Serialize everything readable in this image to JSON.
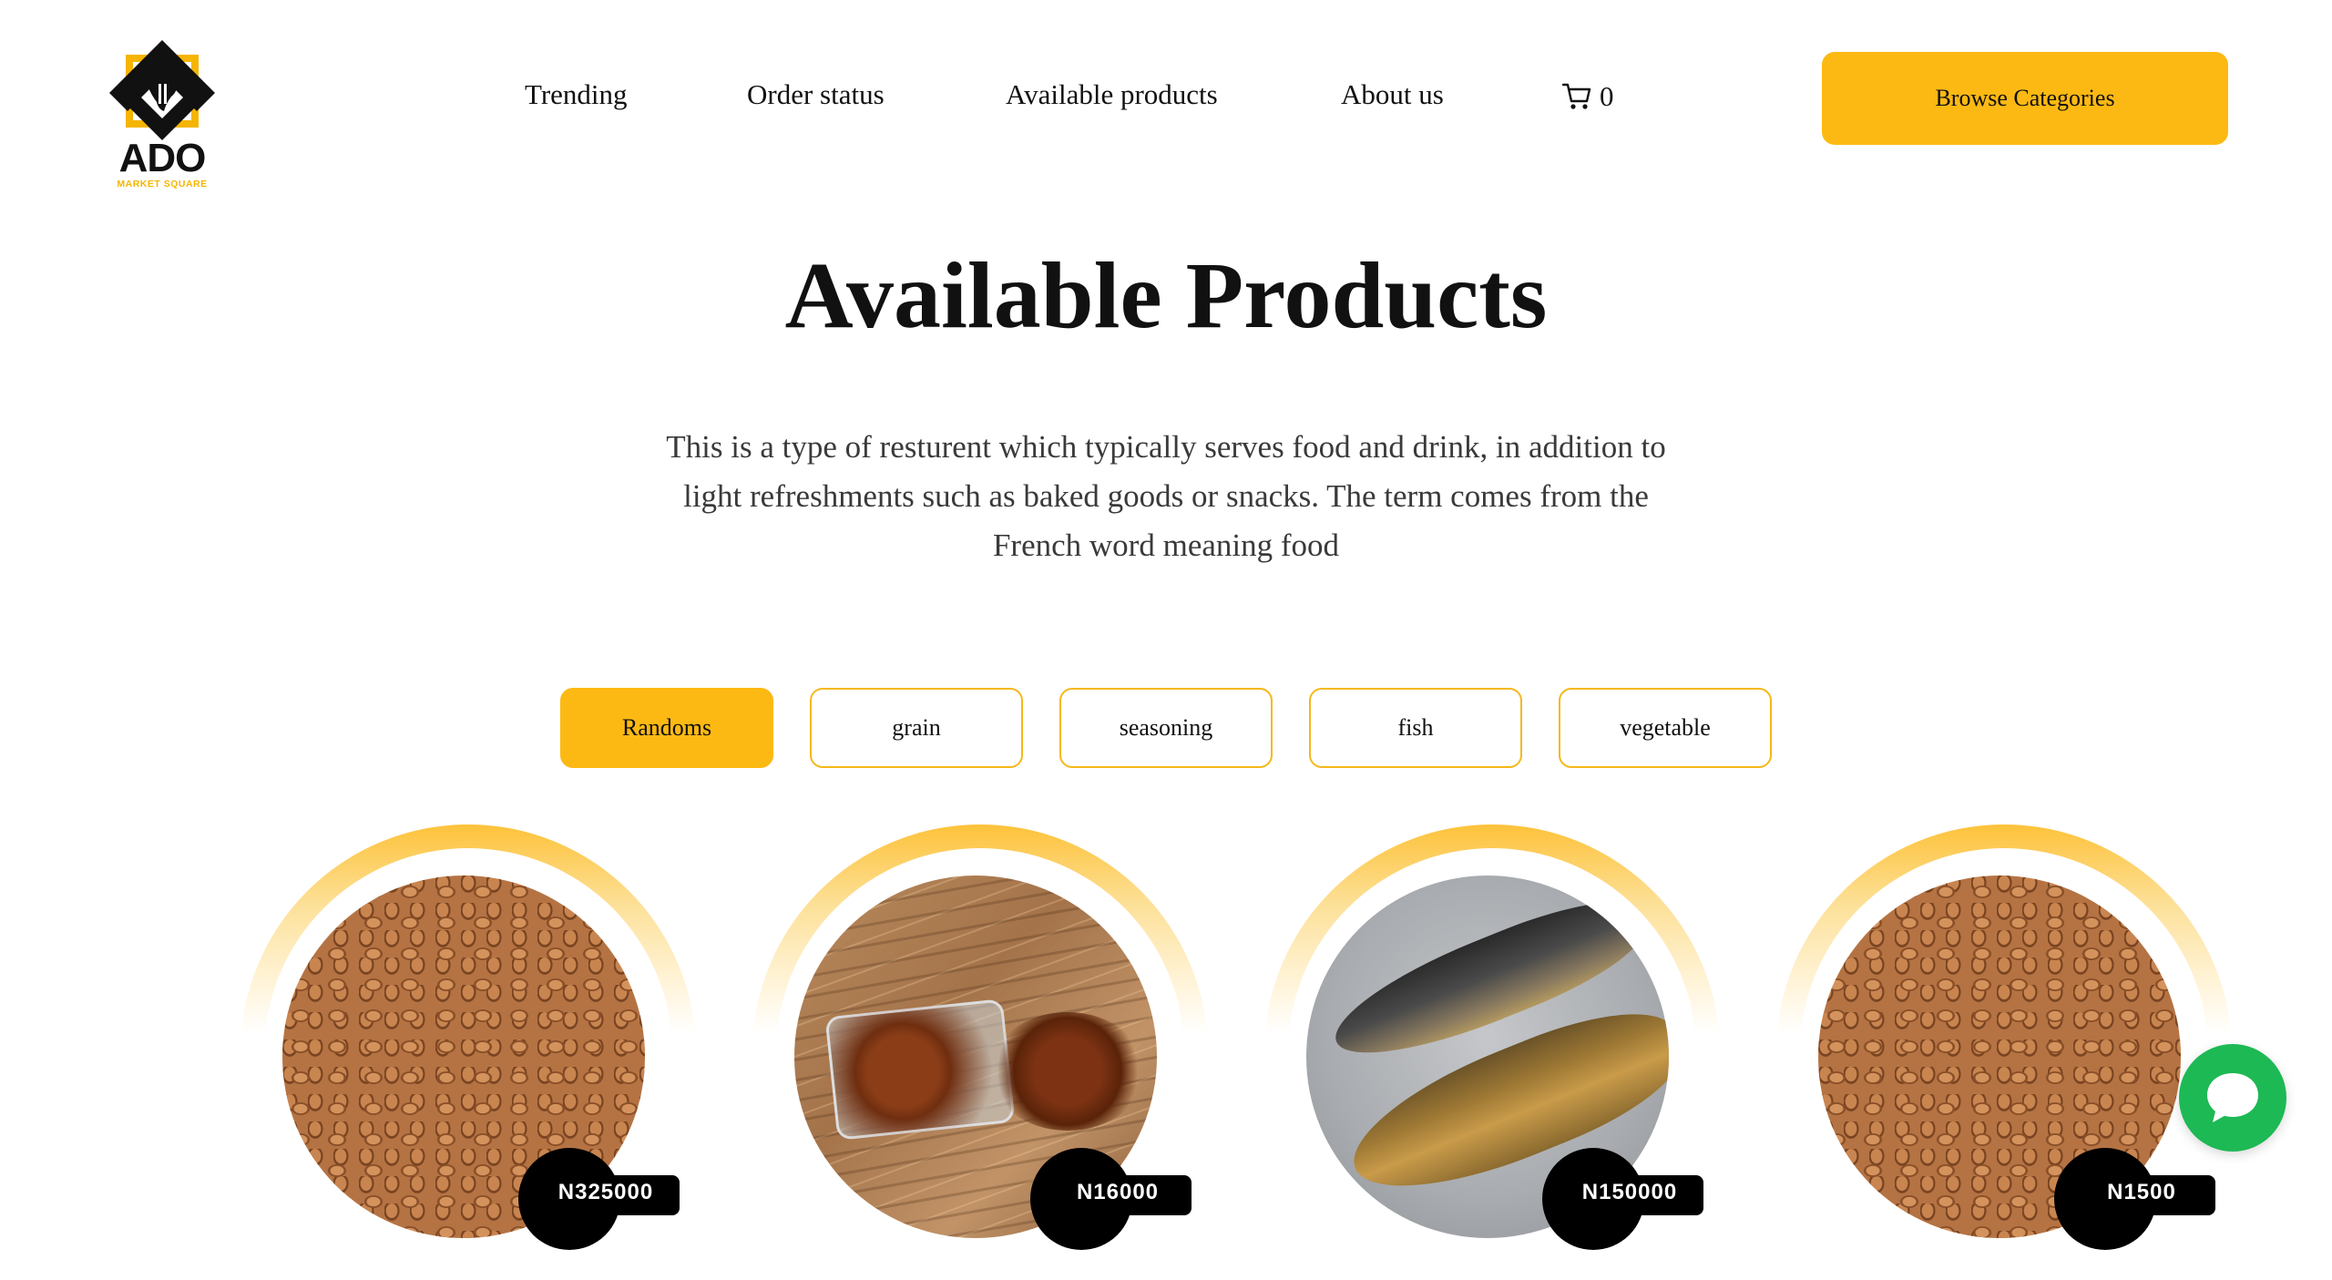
{
  "brand": {
    "name": "ADO",
    "tagline": "MARKET SQUARE",
    "accent": "#fdb913"
  },
  "nav": {
    "items": [
      {
        "label": "Trending"
      },
      {
        "label": "Order status"
      },
      {
        "label": "Available products"
      },
      {
        "label": "About us"
      }
    ],
    "cart_count": "0",
    "cart_icon": "cart-icon",
    "browse_label": "Browse Categories"
  },
  "hero": {
    "title": "Available Products",
    "description": "This is a type of resturent which typically serves food and drink, in addition to light refreshments such as baked goods or snacks. The term comes from the French word meaning food"
  },
  "filters": [
    {
      "label": "Randoms",
      "active": true
    },
    {
      "label": "grain",
      "active": false
    },
    {
      "label": "seasoning",
      "active": false
    },
    {
      "label": "fish",
      "active": false
    },
    {
      "label": "vegetable",
      "active": false
    }
  ],
  "products": [
    {
      "price": "N325000",
      "image": "beans"
    },
    {
      "price": "N16000",
      "image": "spice-jar"
    },
    {
      "price": "N150000",
      "image": "smoked-fish"
    },
    {
      "price": "N1500",
      "image": "beans"
    }
  ],
  "chat": {
    "icon": "chat-bubble-icon",
    "color": "#1db954"
  }
}
